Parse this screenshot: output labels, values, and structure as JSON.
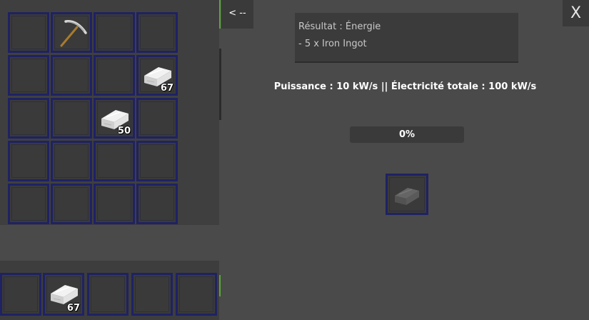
{
  "window": {
    "back_label": "< --",
    "close_label": "X"
  },
  "inventory": {
    "rows": [
      [
        {
          "item": ""
        },
        {
          "item": "pickaxe",
          "icon": "pickaxe-icon"
        },
        {
          "item": ""
        },
        {
          "item": ""
        }
      ],
      [
        {
          "item": ""
        },
        {
          "item": ""
        },
        {
          "item": ""
        },
        {
          "item": "iron-ingot",
          "icon": "iron-ingot-icon",
          "count": "67"
        }
      ],
      [
        {
          "item": ""
        },
        {
          "item": ""
        },
        {
          "item": "iron-ingot",
          "icon": "iron-ingot-icon",
          "count": "50"
        },
        {
          "item": ""
        }
      ],
      [
        {
          "item": ""
        },
        {
          "item": ""
        },
        {
          "item": ""
        },
        {
          "item": ""
        }
      ],
      [
        {
          "item": ""
        },
        {
          "item": ""
        },
        {
          "item": ""
        },
        {
          "item": ""
        }
      ]
    ],
    "hotbar": [
      {
        "item": ""
      },
      {
        "item": "iron-ingot",
        "icon": "iron-ingot-icon",
        "count": "67"
      },
      {
        "item": ""
      },
      {
        "item": ""
      },
      {
        "item": ""
      }
    ]
  },
  "machine": {
    "result_title": "Résultat : Énergie",
    "result_line": "- 5 x Iron Ingot",
    "power_text": "Puissance : 10 kW/s || Électricité totale : 100 kW/s",
    "progress_label": "0%",
    "progress_fraction": 0,
    "output_slot": {
      "item": "iron-ingot",
      "icon": "iron-ingot-icon",
      "state": "ghost"
    }
  },
  "colors": {
    "slot_border": "#1f2263",
    "panel_bg": "#4a4a4a",
    "accent_green": "#5aa83a"
  }
}
